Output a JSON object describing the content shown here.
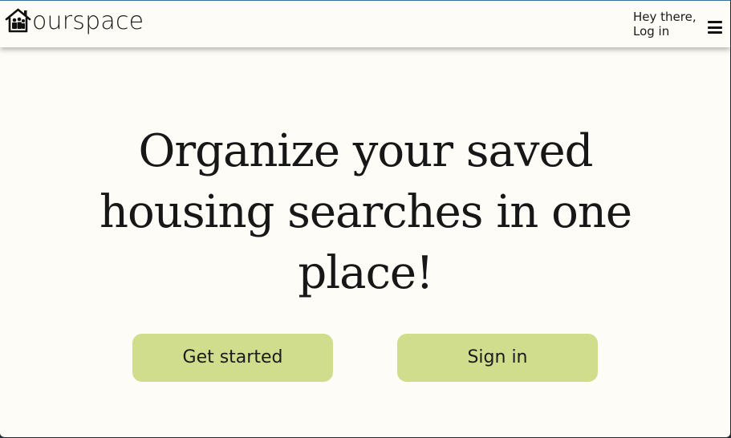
{
  "header": {
    "logo_text": "ourspace",
    "logo_icon": "house-with-people-icon",
    "greeting": "Hey there,",
    "login_label": "Log in",
    "menu_icon": "hamburger-menu-icon"
  },
  "hero": {
    "title": "Organize your saved housing searches in one place!"
  },
  "actions": {
    "get_started_label": "Get started",
    "sign_in_label": "Sign in"
  },
  "colors": {
    "background": "#fdfcf7",
    "button": "#cfdd8d",
    "text": "#171717"
  }
}
